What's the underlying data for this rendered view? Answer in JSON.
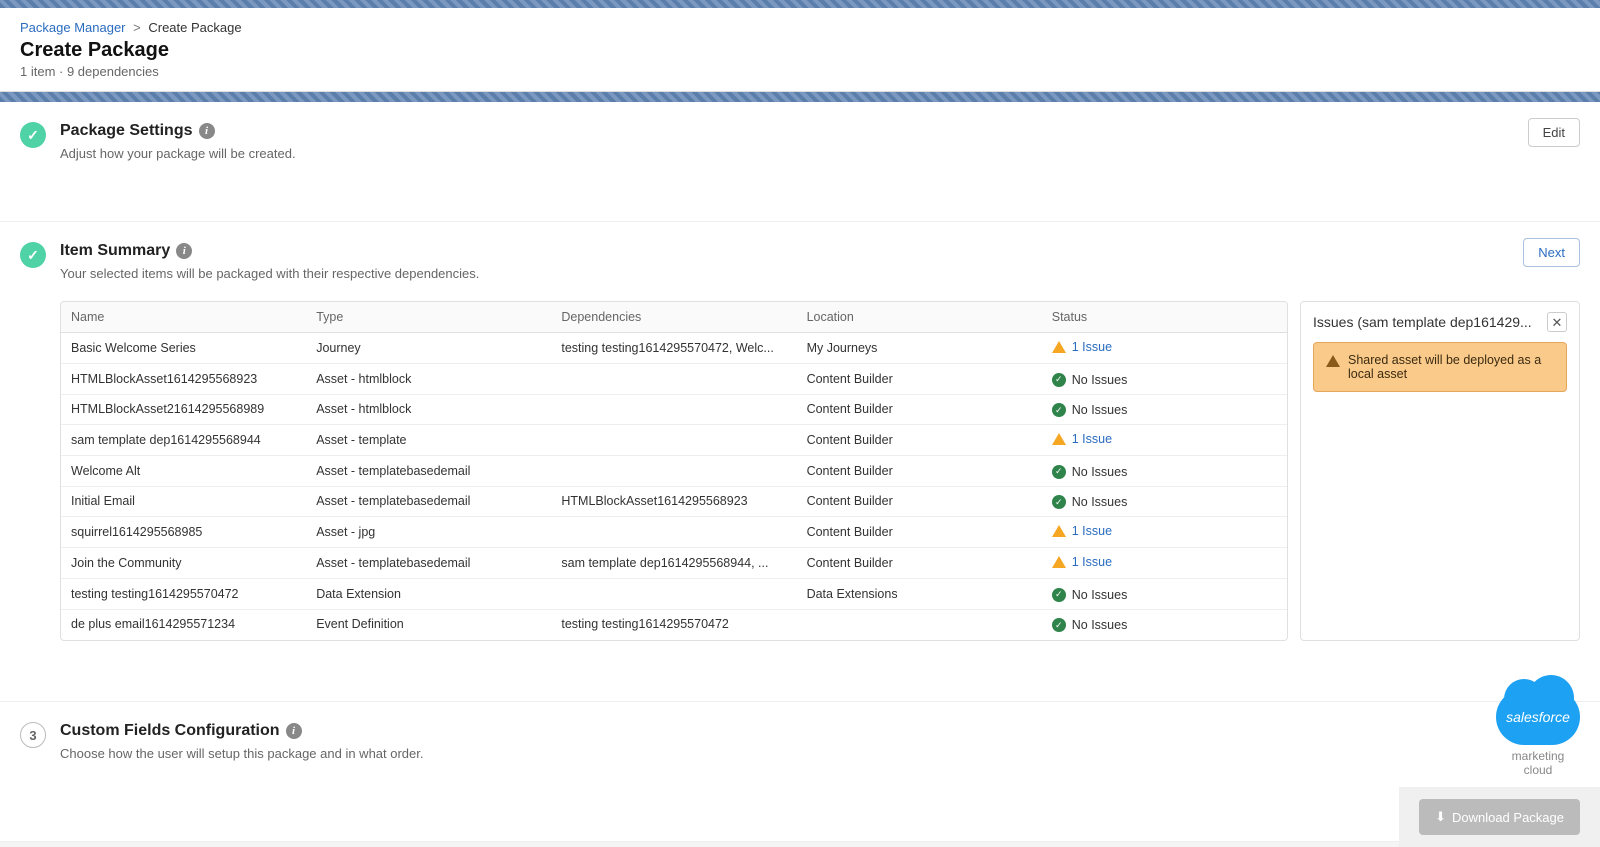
{
  "breadcrumb": {
    "root": "Package Manager",
    "current": "Create Package"
  },
  "page": {
    "title": "Create Package",
    "subtitle": "1 item · 9 dependencies"
  },
  "sections": {
    "settings": {
      "title": "Package Settings",
      "desc": "Adjust how your package will be created.",
      "action": "Edit"
    },
    "summary": {
      "title": "Item Summary",
      "desc": "Your selected items will be packaged with their respective dependencies.",
      "action": "Next"
    },
    "custom": {
      "title": "Custom Fields Configuration",
      "desc": "Choose how the user will setup this package and in what order.",
      "step": "3"
    }
  },
  "table": {
    "headers": {
      "name": "Name",
      "type": "Type",
      "deps": "Dependencies",
      "loc": "Location",
      "status": "Status"
    },
    "rows": [
      {
        "name": "Basic Welcome Series",
        "type": "Journey",
        "deps": "testing testing1614295570472, Welc...",
        "loc": "My Journeys",
        "status": "warn",
        "status_label": "1 Issue"
      },
      {
        "name": "HTMLBlockAsset1614295568923",
        "type": "Asset - htmlblock",
        "deps": "",
        "loc": "Content Builder",
        "status": "ok",
        "status_label": "No Issues"
      },
      {
        "name": "HTMLBlockAsset21614295568989",
        "type": "Asset - htmlblock",
        "deps": "",
        "loc": "Content Builder",
        "status": "ok",
        "status_label": "No Issues"
      },
      {
        "name": "sam template dep1614295568944",
        "type": "Asset - template",
        "deps": "",
        "loc": "Content Builder",
        "status": "warn",
        "status_label": "1 Issue"
      },
      {
        "name": "Welcome Alt",
        "type": "Asset - templatebasedemail",
        "deps": "",
        "loc": "Content Builder",
        "status": "ok",
        "status_label": "No Issues"
      },
      {
        "name": "Initial Email",
        "type": "Asset - templatebasedemail",
        "deps": "HTMLBlockAsset1614295568923",
        "loc": "Content Builder",
        "status": "ok",
        "status_label": "No Issues"
      },
      {
        "name": "squirrel1614295568985",
        "type": "Asset - jpg",
        "deps": "",
        "loc": "Content Builder",
        "status": "warn",
        "status_label": "1 Issue"
      },
      {
        "name": "Join the Community",
        "type": "Asset - templatebasedemail",
        "deps": "sam template dep1614295568944, ...",
        "loc": "Content Builder",
        "status": "warn",
        "status_label": "1 Issue"
      },
      {
        "name": "testing testing1614295570472",
        "type": "Data Extension",
        "deps": "",
        "loc": "Data Extensions",
        "status": "ok",
        "status_label": "No Issues"
      },
      {
        "name": "de plus email1614295571234",
        "type": "Event Definition",
        "deps": "testing testing1614295570472",
        "loc": "",
        "status": "ok",
        "status_label": "No Issues"
      }
    ]
  },
  "issues_panel": {
    "title": "Issues (sam template dep161429...",
    "message": "Shared asset will be deployed as a local asset"
  },
  "footer": {
    "download": "Download Package"
  },
  "branding": {
    "logo": "salesforce",
    "sub1": "marketing",
    "sub2": "cloud"
  }
}
